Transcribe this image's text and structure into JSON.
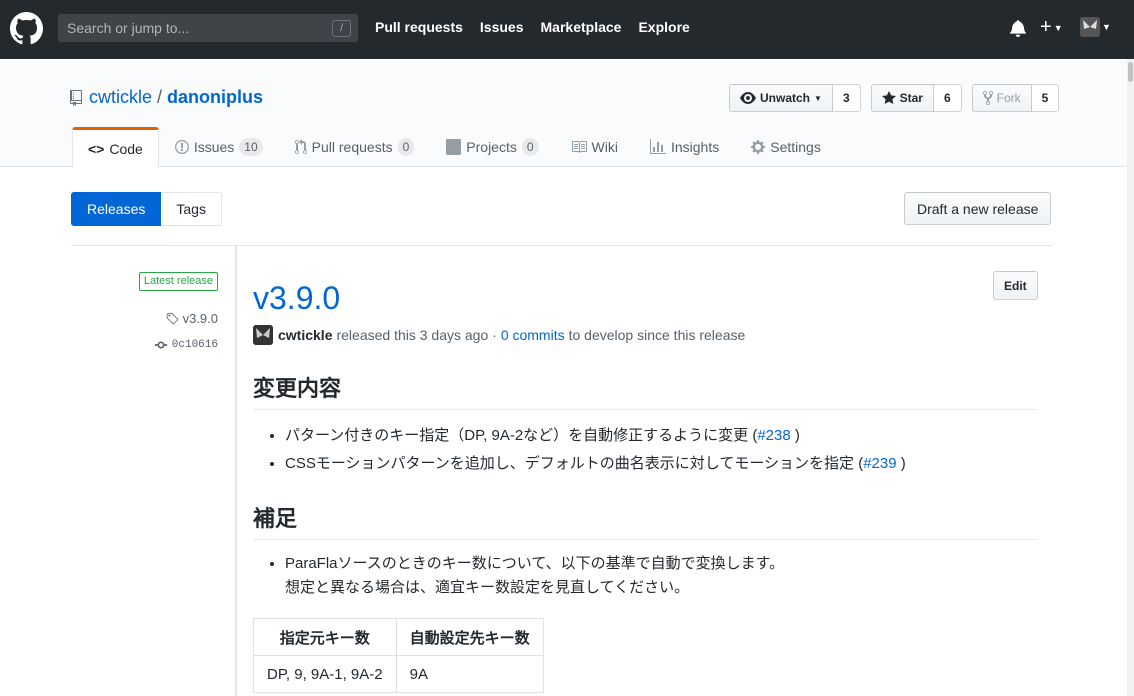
{
  "header": {
    "search_placeholder": "Search or jump to...",
    "search_shortcut": "/",
    "nav": [
      "Pull requests",
      "Issues",
      "Marketplace",
      "Explore"
    ],
    "plus_label": "+"
  },
  "repo": {
    "owner": "cwtickle",
    "separator": "/",
    "name": "danoniplus",
    "watch_label": "Unwatch",
    "watch_count": "3",
    "star_label": "Star",
    "star_count": "6",
    "fork_label": "Fork",
    "fork_count": "5",
    "tabs": [
      {
        "label": "Code",
        "count": null
      },
      {
        "label": "Issues",
        "count": "10"
      },
      {
        "label": "Pull requests",
        "count": "0"
      },
      {
        "label": "Projects",
        "count": "0"
      },
      {
        "label": "Wiki",
        "count": null
      },
      {
        "label": "Insights",
        "count": null
      },
      {
        "label": "Settings",
        "count": null
      }
    ]
  },
  "subnav": {
    "releases": "Releases",
    "tags": "Tags",
    "draft_button": "Draft a new release"
  },
  "release": {
    "badge": "Latest release",
    "tag": "v3.9.0",
    "commit": "0c10616",
    "title": "v3.9.0",
    "edit_label": "Edit",
    "author": "cwtickle",
    "released_text": "released this 3 days ago ·",
    "commits_link": "0 commits",
    "commits_suffix": "to develop since this release",
    "section1_heading": "変更内容",
    "section1_items": [
      {
        "text": "パターン付きのキー指定（DP, 9A-2など）を自動修正するように変更 (",
        "link": "#238",
        "end": ")"
      },
      {
        "text": "CSSモーションパターンを追加し、デフォルトの曲名表示に対してモーションを指定 (",
        "link": "#239",
        "end": ")"
      }
    ],
    "section2_heading": "補足",
    "section2_item_line1": "ParaFlaソースのときのキー数について、以下の基準で自動で変換します。",
    "section2_item_line2": "想定と異なる場合は、適宜キー数設定を見直してください。",
    "table": {
      "headers": [
        "指定元キー数",
        "自動設定先キー数"
      ],
      "rows": [
        [
          "DP, 9, 9A-1, 9A-2",
          "9A"
        ]
      ]
    }
  }
}
